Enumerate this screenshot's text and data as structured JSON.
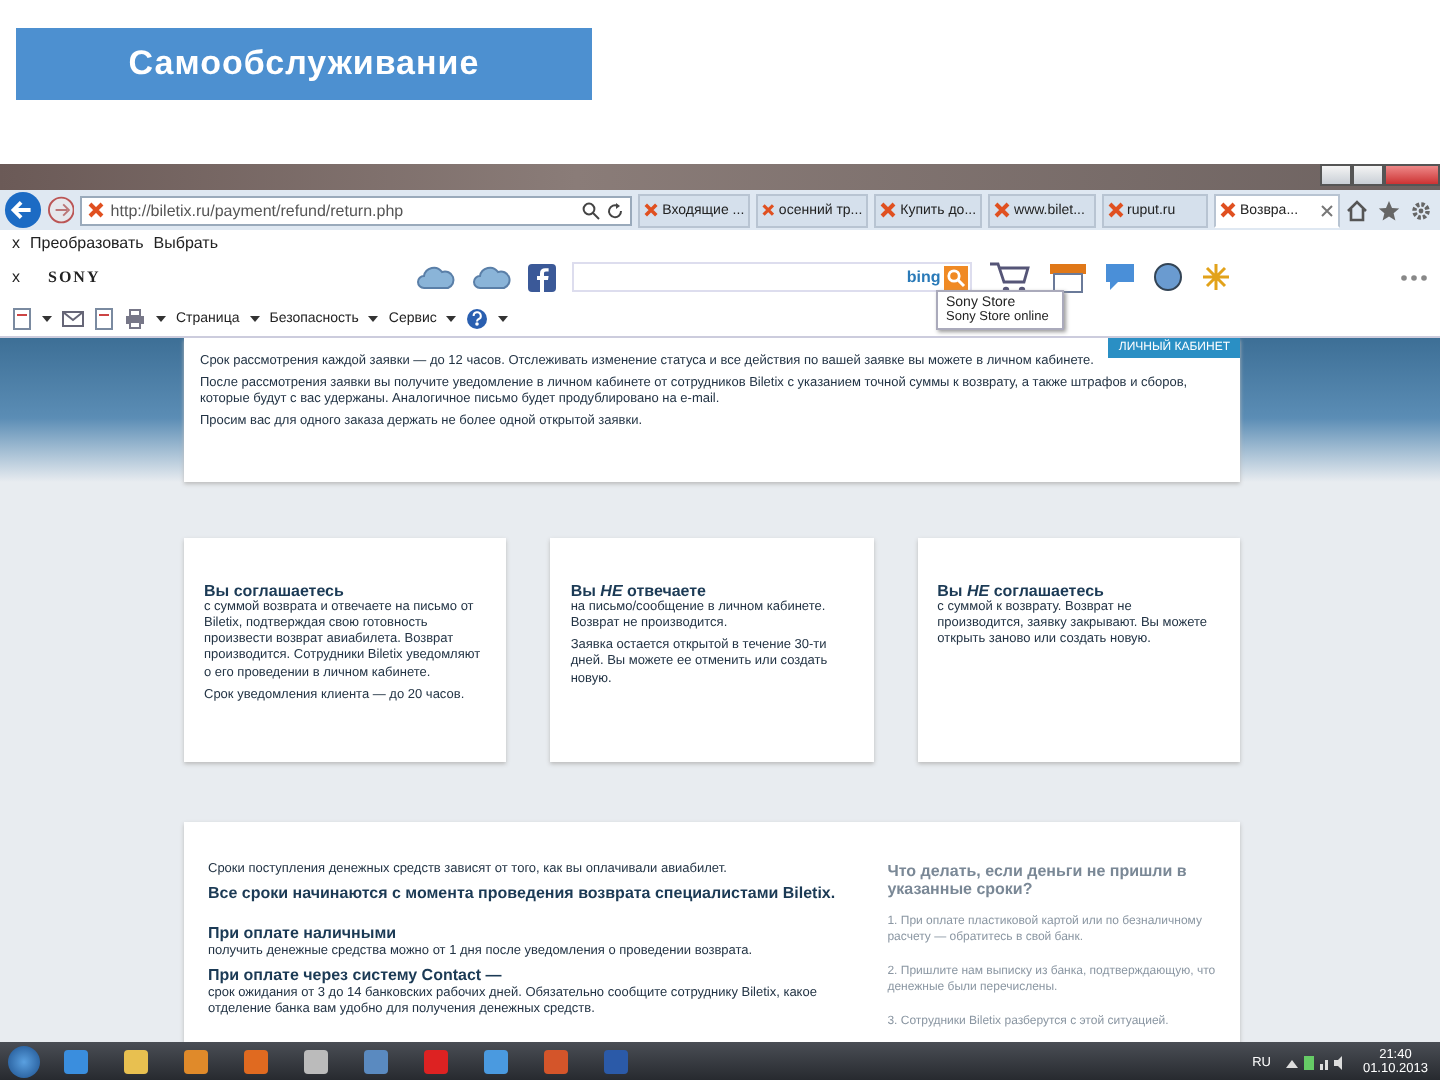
{
  "slide_title": "Самообслуживание",
  "browser": {
    "url": "http://biletix.ru/payment/refund/return.php",
    "tabs": [
      {
        "label": "Входящие ...",
        "selected": false
      },
      {
        "label": "осенний тр...",
        "selected": false
      },
      {
        "label": "Купить до...",
        "selected": false
      },
      {
        "label": "www.bilet...",
        "selected": false
      },
      {
        "label": "ruput.ru",
        "selected": false
      },
      {
        "label": "Возвра...",
        "selected": true
      }
    ],
    "favorites_bar": {
      "close": "x",
      "items": [
        "Преобразовать",
        "Выбрать"
      ]
    },
    "sony_toolbar": {
      "close": "x",
      "logo": "SONY",
      "search_logo": "bing",
      "tooltip": {
        "title": "Sony Store",
        "subtitle": "Sony Store online"
      }
    },
    "command_bar": {
      "menus": [
        "Страница",
        "Безопасность",
        "Сервис"
      ]
    }
  },
  "page": {
    "account_button": "ЛИЧНЫЙ КАБИНЕТ",
    "intro": [
      "Срок рассмотрения каждой заявки — до 12 часов. Отслеживать изменение статуса и все действия по вашей заявке вы можете в личном кабинете.",
      "После рассмотрения заявки вы получите уведомление в личном кабинете от сотрудников Biletix с указанием точной суммы к возврату, а также штрафов и сборов, которые будут с вас удержаны. Аналогичное письмо будет продублировано на e-mail.",
      "Просим вас для одного заказа держать не более одной открытой заявки."
    ],
    "outcomes": [
      {
        "title": "Вы соглашаетесь",
        "body": [
          "с суммой возврата и отвечаете на письмо от Biletix, подтверждая свою готовность произвести возврат авиабилета. Возврат производится. Сотрудники Biletix уведомляют о его проведении в личном кабинете.",
          "Срок уведомления клиента — до 20 часов."
        ]
      },
      {
        "title": "Вы *НЕ* отвечаете",
        "body": [
          "на письмо/сообщение в личном кабинете. Возврат не производится.",
          "Заявка остается открытой в течение 30-ти дней. Вы можете ее отменить или создать новую."
        ]
      },
      {
        "title": "Вы *НЕ* соглашаетесь",
        "body": [
          "с суммой к возврату. Возврат не производится, заявку закрывают. Вы можете открыть заново или создать новую."
        ]
      }
    ],
    "timing": {
      "paragraphs": [
        {
          "kind": "plain",
          "text": "Сроки поступления денежных средств зависят от того, как вы оплачивали авиабилет."
        },
        {
          "kind": "lead",
          "text": "Все сроки начинаются с момента проведения возврата специалистами Biletix."
        },
        {
          "kind": "heading",
          "text": "При оплате наличными"
        },
        {
          "kind": "plain",
          "text": "получить денежные средства можно от 1 дня после уведомления о проведении возврата."
        },
        {
          "kind": "heading",
          "text": "При оплате через систему Contact —"
        },
        {
          "kind": "plain",
          "text": "срок ожидания от 3 до 14 банковских рабочих дней. Обязательно сообщите сотруднику Biletix, какое отделение банка вам удобно для получения денежных средств."
        }
      ],
      "help": {
        "title": "Что делать, если деньги не пришли в указанные сроки?",
        "steps": [
          "1. При оплате пластиковой картой или по безналичному расчету — обратитесь в свой банк.",
          "2. Пришлите нам выписку из банка, подтверждающую, что денежные были перечислены.",
          "3. Сотрудники Biletix разберутся с этой ситуацией."
        ]
      }
    }
  },
  "taskbar": {
    "language": "RU",
    "time": "21:40",
    "date": "01.10.2013"
  }
}
